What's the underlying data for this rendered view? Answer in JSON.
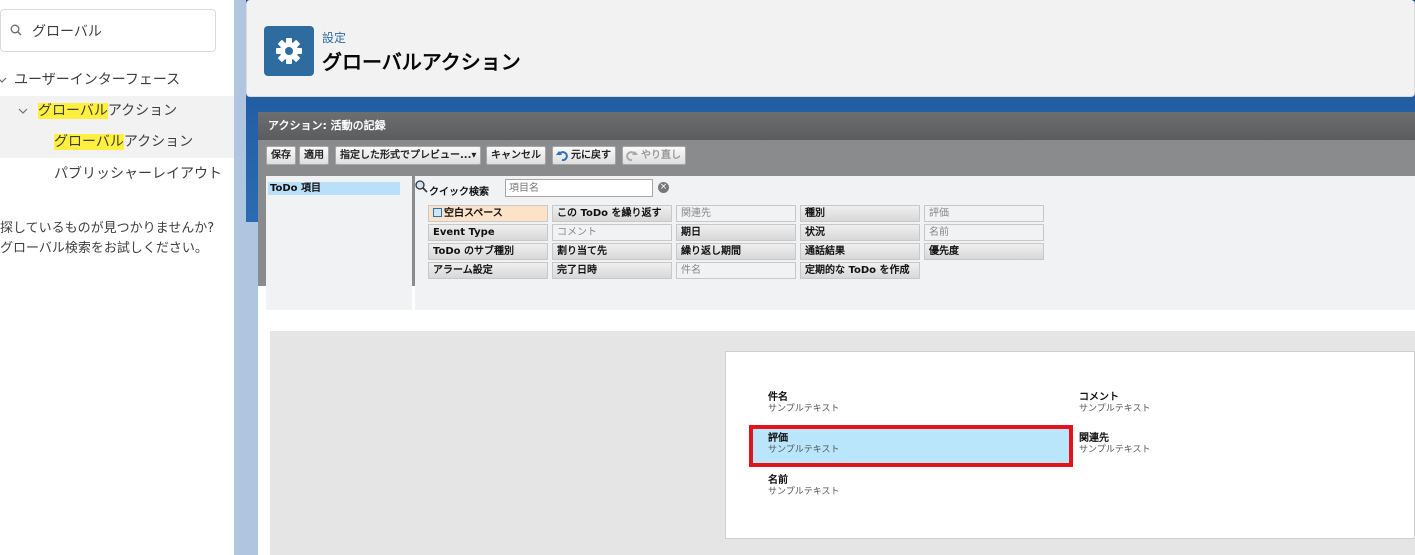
{
  "sidebar": {
    "search_value": "グローバル",
    "tree": [
      {
        "label_pre": "",
        "label_hl": "",
        "label_post": "ユーザーインターフェース"
      },
      {
        "label_pre": "",
        "label_hl": "グローバル",
        "label_post": "アクション"
      },
      {
        "label_pre": "",
        "label_hl": "グローバル",
        "label_post": "アクション"
      },
      {
        "label_pre": "",
        "label_hl": "",
        "label_post": "パブリッシャーレイアウト"
      }
    ],
    "not_found_line1": "探しているものが見つかりませんか?",
    "not_found_line2": "グローバル検索をお試しください。"
  },
  "header": {
    "eyebrow": "設定",
    "title": "グローバルアクション"
  },
  "panel": {
    "title": "アクション: 活動の記録"
  },
  "toolbar": {
    "save": "保存",
    "apply": "適用",
    "preview": "指定した形式でプレビュー...▾",
    "cancel": "キャンセル",
    "undo": "元に戻す",
    "redo": "やり直し"
  },
  "left_list": {
    "selected": "ToDo 項目"
  },
  "quick_search": {
    "label": "クイック検索",
    "placeholder": "項目名"
  },
  "fields": [
    [
      "空白スペース",
      "この ToDo を繰り返す",
      "関連先",
      "種別",
      "評価"
    ],
    [
      "Event Type",
      "コメント",
      "期日",
      "状況",
      "名前"
    ],
    [
      "ToDo のサブ種別",
      "割り当て先",
      "繰り返し期間",
      "通話結果",
      "優先度"
    ],
    [
      "アラーム設定",
      "完了日時",
      "件名",
      "定期的な ToDo を作成",
      ""
    ]
  ],
  "layout": {
    "sample": "サンプルテキスト",
    "items": {
      "subject": "件名",
      "comment": "コメント",
      "rating": "評価",
      "related": "関連先",
      "name": "名前"
    }
  },
  "colors": {
    "highlight": "#fff03f",
    "header_icon": "#2e6b9e",
    "selection_border": "#e3131b",
    "selection_fill": "#b9e6fb"
  }
}
